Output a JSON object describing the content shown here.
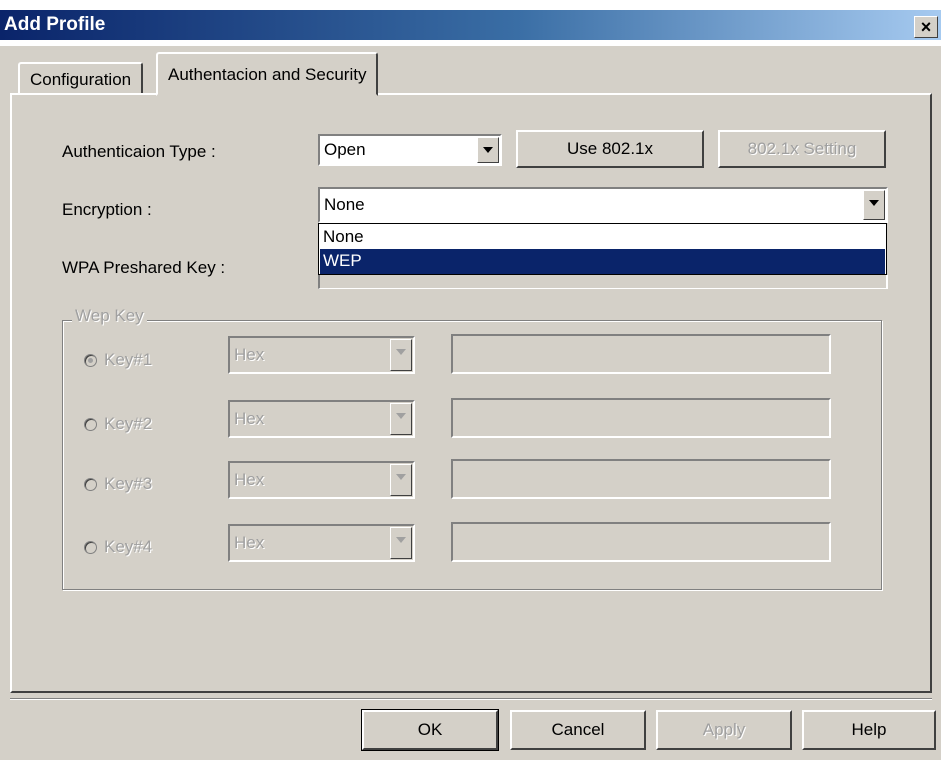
{
  "window": {
    "title": "Add Profile",
    "close_glyph": "×"
  },
  "tabs": [
    {
      "label": "Configuration"
    },
    {
      "label": "Authentacion and Security"
    }
  ],
  "auth": {
    "label": "Authenticaion Type :",
    "value": "Open",
    "use_8021x_button": "Use 802.1x",
    "setting_8021x_button": "802.1x Setting"
  },
  "encryption": {
    "label": "Encryption :",
    "value": "None",
    "options": [
      "None",
      "WEP"
    ],
    "highlighted": "WEP"
  },
  "wpa": {
    "label": "WPA Preshared Key :"
  },
  "wep": {
    "group_title": "Wep Key",
    "keys": [
      {
        "label": "Key#1",
        "format": "Hex",
        "checked": true
      },
      {
        "label": "Key#2",
        "format": "Hex",
        "checked": false
      },
      {
        "label": "Key#3",
        "format": "Hex",
        "checked": false
      },
      {
        "label": "Key#4",
        "format": "Hex",
        "checked": false
      }
    ]
  },
  "footer": {
    "ok": "OK",
    "cancel": "Cancel",
    "apply": "Apply",
    "help": "Help"
  },
  "colors": {
    "titlebar_start": "#0a246a",
    "titlebar_end": "#a6caf0",
    "face": "#d4d0c8",
    "highlight": "#0a246a"
  },
  "icons": [
    "close-icon",
    "dropdown-arrow-icon",
    "radio-icon"
  ]
}
